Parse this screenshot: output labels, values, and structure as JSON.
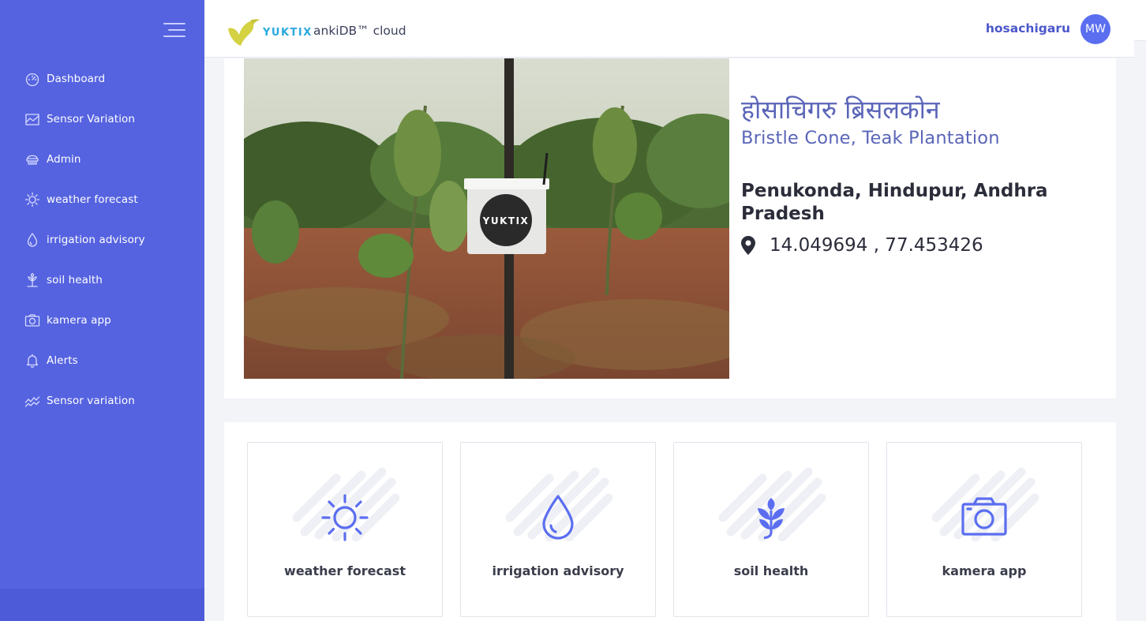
{
  "sidebar": {
    "items": [
      {
        "label": "Dashboard",
        "icon": "dashboard-icon"
      },
      {
        "label": "Sensor Variation",
        "icon": "chart-area-icon"
      },
      {
        "label": "Admin",
        "icon": "admin-icon"
      },
      {
        "label": "weather forecast",
        "icon": "sun-icon"
      },
      {
        "label": "irrigation advisory",
        "icon": "water-drop-icon"
      },
      {
        "label": "soil health",
        "icon": "plant-icon"
      },
      {
        "label": "kamera app",
        "icon": "camera-icon"
      },
      {
        "label": "Alerts",
        "icon": "bell-icon"
      },
      {
        "label": "Sensor variation",
        "icon": "line-chart-icon"
      }
    ]
  },
  "header": {
    "logo_text": "YUKTIX",
    "app_title": "ankiDB™ cloud",
    "username": "hosachigaru",
    "avatar_initials": "MW"
  },
  "station": {
    "device_label": "YUKTIX",
    "name_local": "होसाचिगरु ब्रिसलकोन",
    "name_en": "Bristle Cone, Teak Plantation",
    "location": "Penukonda, Hindupur, Andhra Pradesh",
    "coords": "14.049694 ,  77.453426"
  },
  "features": [
    {
      "label": "weather forecast",
      "icon": "sun-icon"
    },
    {
      "label": "irrigation advisory",
      "icon": "water-drop-icon"
    },
    {
      "label": "soil health",
      "icon": "plant-icon"
    },
    {
      "label": "kamera app",
      "icon": "camera-icon"
    }
  ],
  "colors": {
    "sidebar": "#5563e0",
    "accent": "#5b6ef0",
    "title": "#5a65b8"
  }
}
